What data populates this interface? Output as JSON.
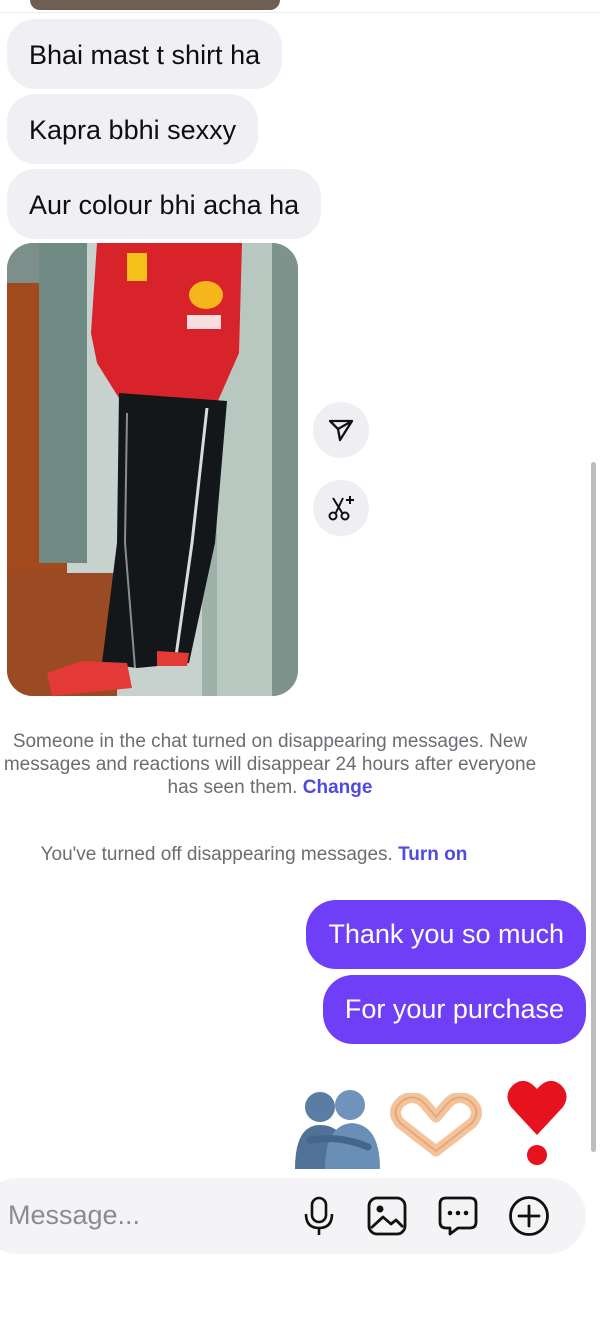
{
  "messages_incoming": [
    "Bhai mast t shirt ha",
    "Kapra bbhi sexxy",
    "Aur colour bhi acha ha"
  ],
  "photo": {
    "icon": "shared-photo"
  },
  "side_actions": {
    "share_icon": "send-icon",
    "edit_icon": "ai-edit-icon"
  },
  "system": {
    "disappearing_on": "Someone in the chat turned on disappearing messages. New messages and reactions will disappear 24 hours after everyone has seen them.",
    "disappearing_on_link": "Change",
    "disappearing_off": "You've turned off disappearing messages.",
    "disappearing_off_link": "Turn on"
  },
  "messages_outgoing": [
    "Thank you so much",
    "For your purchase"
  ],
  "reactions": [
    "people-hugging-emoji",
    "heart-hands-emoji",
    "heart-exclamation-emoji"
  ],
  "composer": {
    "placeholder": "Message...",
    "icons": [
      "microphone-icon",
      "image-icon",
      "sticker-chat-icon",
      "plus-icon"
    ]
  },
  "colors": {
    "incoming_bubble": "#efeff4",
    "outgoing_bubble": "#6e3ff6",
    "link": "#4d4be0"
  }
}
